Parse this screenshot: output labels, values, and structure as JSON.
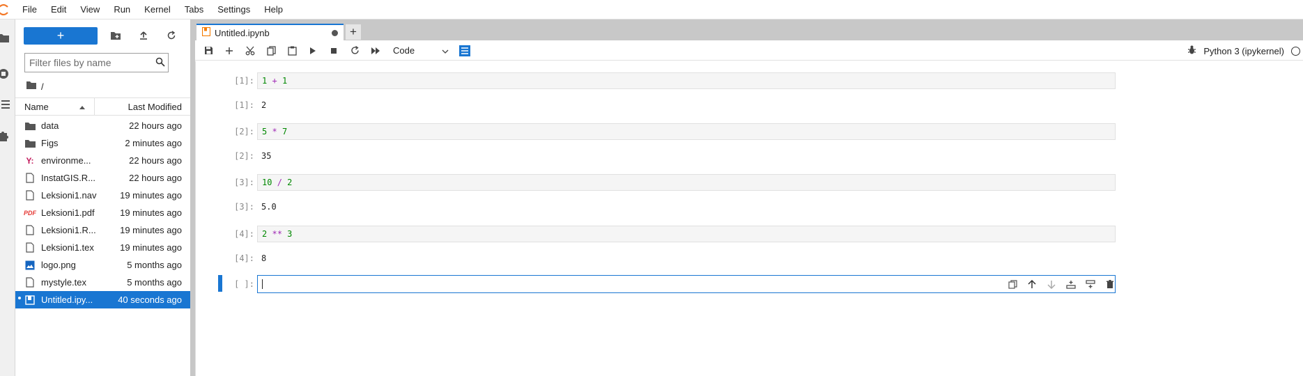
{
  "menubar": {
    "items": [
      "File",
      "Edit",
      "View",
      "Run",
      "Kernel",
      "Tabs",
      "Settings",
      "Help"
    ]
  },
  "filebrowser": {
    "new_label": "+",
    "search_placeholder": "Filter files by name",
    "breadcrumb": "/",
    "columns": {
      "name": "Name",
      "modified": "Last Modified"
    },
    "files": [
      {
        "name": "data",
        "modified": "22 hours ago",
        "icon": "folder-icon"
      },
      {
        "name": "Figs",
        "modified": "2 minutes ago",
        "icon": "folder-icon"
      },
      {
        "name": "environme...",
        "modified": "22 hours ago",
        "icon": "yaml-icon"
      },
      {
        "name": "InstatGIS.R...",
        "modified": "22 hours ago",
        "icon": "file-icon"
      },
      {
        "name": "Leksioni1.nav",
        "modified": "19 minutes ago",
        "icon": "file-icon"
      },
      {
        "name": "Leksioni1.pdf",
        "modified": "19 minutes ago",
        "icon": "pdf-icon"
      },
      {
        "name": "Leksioni1.R...",
        "modified": "19 minutes ago",
        "icon": "file-icon"
      },
      {
        "name": "Leksioni1.tex",
        "modified": "19 minutes ago",
        "icon": "file-icon"
      },
      {
        "name": "logo.png",
        "modified": "5 months ago",
        "icon": "image-icon"
      },
      {
        "name": "mystyle.tex",
        "modified": "5 months ago",
        "icon": "file-icon"
      },
      {
        "name": "Untitled.ipy...",
        "modified": "40 seconds ago",
        "icon": "notebook-icon"
      }
    ]
  },
  "tab": {
    "label": "Untitled.ipynb"
  },
  "toolbar": {
    "cell_type": "Code",
    "kernel": "Python 3 (ipykernel)"
  },
  "cells": [
    {
      "in_prompt": "[1]:",
      "code": [
        "1",
        "+",
        "1"
      ],
      "out_prompt": "[1]:",
      "output": "2"
    },
    {
      "in_prompt": "[2]:",
      "code": [
        "5",
        "*",
        "7"
      ],
      "out_prompt": "[2]:",
      "output": "35"
    },
    {
      "in_prompt": "[3]:",
      "code": [
        "10",
        "/",
        "2"
      ],
      "out_prompt": "[3]:",
      "output": "5.0"
    },
    {
      "in_prompt": "[4]:",
      "code": [
        "2",
        "**",
        "3"
      ],
      "out_prompt": "[4]:",
      "output": "8"
    }
  ],
  "active_cell": {
    "prompt": "[ ]:"
  },
  "colors": {
    "accent": "#1976d2",
    "number": "#008800",
    "operator": "#a02ab6",
    "logo": "#f37726"
  }
}
